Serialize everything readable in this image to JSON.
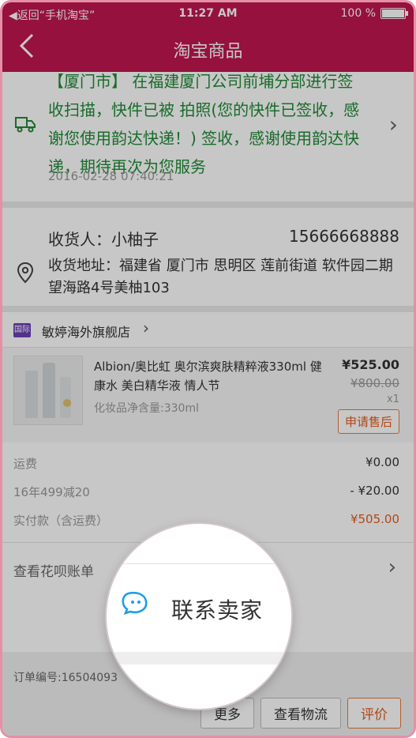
{
  "status_bar": {
    "back_text": "◀返回“手机淘宝”",
    "time": "11:27 AM",
    "battery": "100 %"
  },
  "nav": {
    "title": "淘宝商品"
  },
  "logistics": {
    "text": "【厦门市】 在福建厦门公司前埔分部进行签收扫描，快件已被 拍照(您的快件已签收，感谢您使用韵达快递！) 签收，感谢使用韵达快递，期待再次为您服务",
    "time": "2016-02-28 07:40:21",
    "text_color": "#1f8b36"
  },
  "address": {
    "recipient": "收货人：小柚子",
    "phone": "15666668888",
    "address": "收货地址：福建省 厦门市 思明区 莲前街道 软件园二期望海路4号美柚103"
  },
  "shop": {
    "tag": "国际",
    "name": "敏婷海外旗舰店"
  },
  "product": {
    "title": "Albion/奥比虹 奥尔滨爽肤精粹液330ml 健康水 美白精华液 情人节",
    "spec": "化妆品净含量:330ml",
    "price": "¥525.00",
    "original_price": "¥800.00",
    "quantity": "x1",
    "after_sale_label": "申请售后"
  },
  "fees": [
    {
      "label": "运费",
      "value": "¥0.00"
    },
    {
      "label": "16年499减20",
      "value": "- ¥20.00"
    },
    {
      "label": "实付款（含运费）",
      "value": "¥505.00"
    }
  ],
  "huabei": {
    "label": "查看花呗账单"
  },
  "contact_seller": {
    "label": "联系卖家"
  },
  "order": {
    "number": "订单编号:16504093"
  },
  "buttons": {
    "more": "更多",
    "logistics": "查看物流",
    "review": "评价"
  },
  "colors": {
    "brand": "#c0174f",
    "accent_orange": "#e65b1c",
    "contact_icon": "#1e9ee8"
  },
  "icons": [
    "back-chevron-icon",
    "truck-icon",
    "location-pin-icon",
    "shop-badge-icon",
    "chevron-right-icon",
    "chat-bubble-icon",
    "battery-icon"
  ]
}
